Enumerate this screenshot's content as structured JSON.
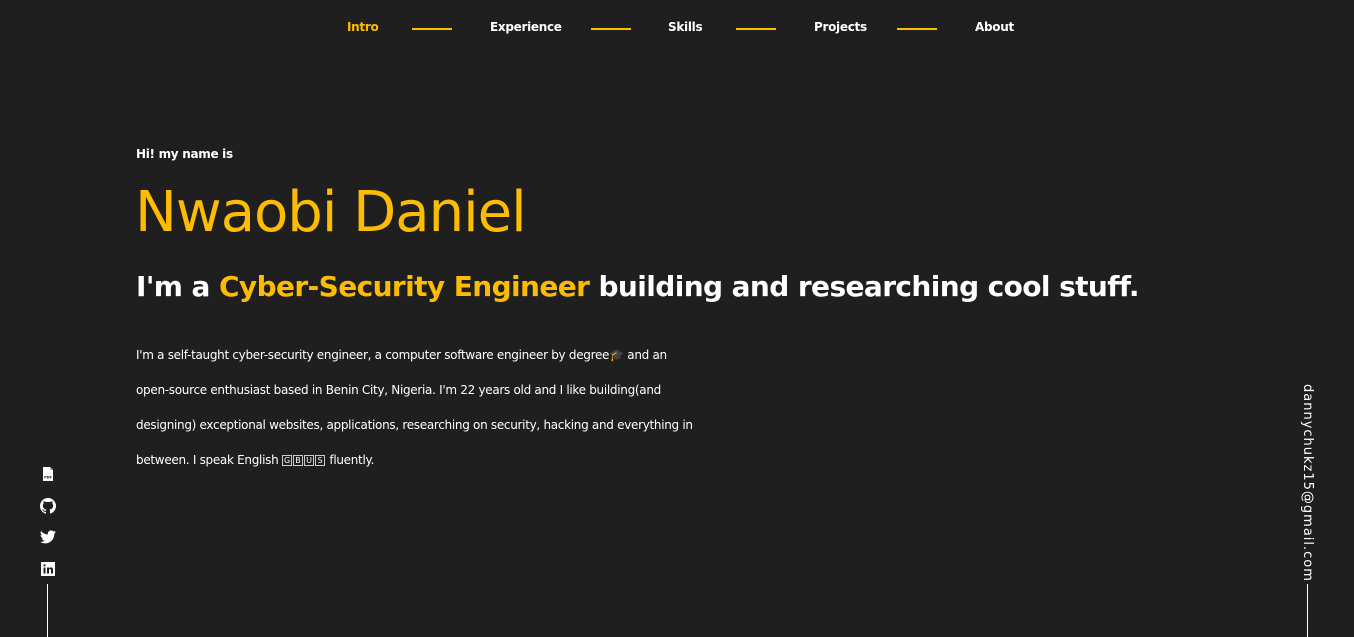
{
  "nav": {
    "items": [
      {
        "label": "Intro",
        "active": true
      },
      {
        "label": "Experience"
      },
      {
        "label": "Skills"
      },
      {
        "label": "Projects"
      },
      {
        "label": "About"
      }
    ]
  },
  "hero": {
    "greeting": "Hi! my name is",
    "name": "Nwaobi Daniel",
    "tagline_prefix": "I'm a ",
    "tagline_highlight": "Cyber-Security Engineer",
    "tagline_suffix": " building and researching cool stuff.",
    "bio_main": "I'm a self-taught cyber-security engineer, a computer software engineer by degree🎓 and an open-source enthusiast based in Benin City, Nigeria. I'm 22 years old and I like building(and designing) exceptional websites, applications, researching on security, hacking and everything in between. I speak English ",
    "flag_letters": [
      "G",
      "B",
      "U",
      "S"
    ],
    "bio_end": " fluently."
  },
  "social": {
    "icons": [
      "pdf-icon",
      "github-icon",
      "twitter-icon",
      "linkedin-icon"
    ]
  },
  "email": "dannychukz15@gmail.com",
  "colors": {
    "accent": "#fcbc04",
    "background": "#1f1f1f"
  }
}
